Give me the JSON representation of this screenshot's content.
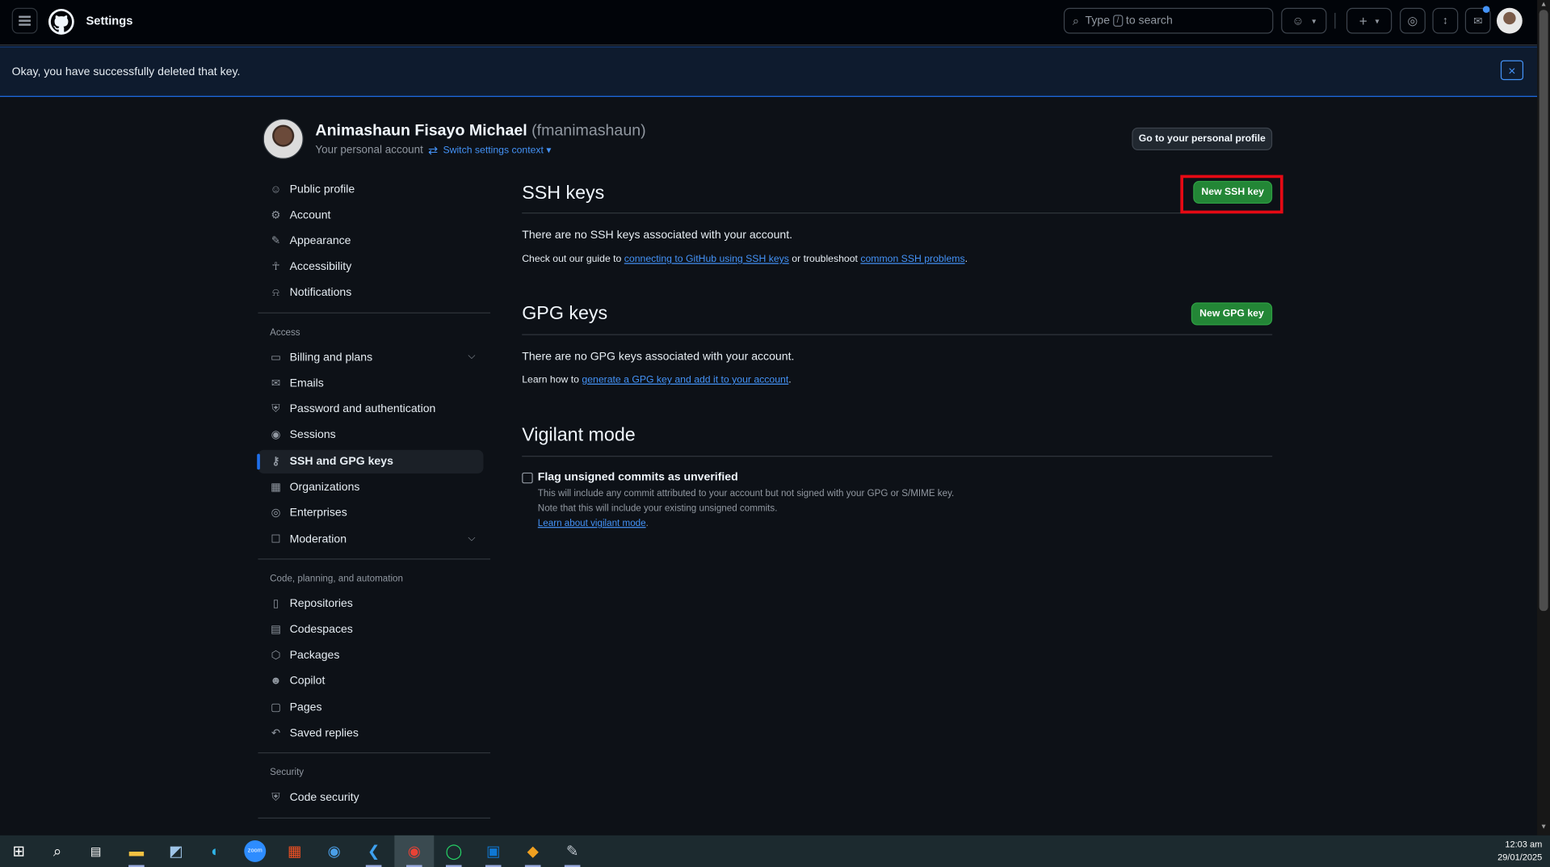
{
  "header": {
    "title": "Settings",
    "search_prefix": "Type",
    "search_key": "/",
    "search_suffix": "to search"
  },
  "flash": {
    "message": "Okay, you have successfully deleted that key.",
    "close": "×"
  },
  "profile": {
    "name": "Animashaun Fisayo Michael",
    "handle": "(fmanimashaun)",
    "subtitle": "Your personal account",
    "switch_label": "Switch settings context",
    "goto_button": "Go to your personal profile"
  },
  "sidebar": {
    "top_items": [
      {
        "label": "Public profile",
        "icon": "person-icon"
      },
      {
        "label": "Account",
        "icon": "gear-icon"
      },
      {
        "label": "Appearance",
        "icon": "paintbrush-icon"
      },
      {
        "label": "Accessibility",
        "icon": "accessibility-icon"
      },
      {
        "label": "Notifications",
        "icon": "bell-icon"
      }
    ],
    "access_heading": "Access",
    "access_items": [
      {
        "label": "Billing and plans",
        "icon": "credit-card-icon"
      },
      {
        "label": "Emails",
        "icon": "mail-icon"
      },
      {
        "label": "Password and authentication",
        "icon": "shield-lock-icon"
      },
      {
        "label": "Sessions",
        "icon": "broadcast-icon"
      },
      {
        "label": "SSH and GPG keys",
        "icon": "key-icon"
      },
      {
        "label": "Organizations",
        "icon": "organization-icon"
      },
      {
        "label": "Enterprises",
        "icon": "globe-icon"
      },
      {
        "label": "Moderation",
        "icon": "report-icon"
      }
    ],
    "code_heading": "Code, planning, and automation",
    "code_items": [
      {
        "label": "Repositories",
        "icon": "repo-icon"
      },
      {
        "label": "Codespaces",
        "icon": "codespaces-icon"
      },
      {
        "label": "Packages",
        "icon": "package-icon"
      },
      {
        "label": "Copilot",
        "icon": "copilot-icon"
      },
      {
        "label": "Pages",
        "icon": "browser-icon"
      },
      {
        "label": "Saved replies",
        "icon": "reply-icon"
      }
    ],
    "security_heading": "Security",
    "security_items": [
      {
        "label": "Code security",
        "icon": "shield-icon"
      }
    ]
  },
  "ssh": {
    "title": "SSH keys",
    "new_button": "New SSH key",
    "empty": "There are no SSH keys associated with your account.",
    "guide_prefix": "Check out our guide to",
    "guide_link": "connecting to GitHub using SSH keys",
    "guide_mid": "or troubleshoot",
    "guide_link2": "common SSH problems",
    "guide_end": "."
  },
  "gpg": {
    "title": "GPG keys",
    "new_button": "New GPG key",
    "empty": "There are no GPG keys associated with your account.",
    "learn_prefix": "Learn how to",
    "learn_link": "generate a GPG key and add it to your account",
    "learn_end": "."
  },
  "vigilant": {
    "title": "Vigilant mode",
    "checkbox_label": "Flag unsigned commits as unverified",
    "checked": false,
    "note1": "This will include any commit attributed to your account but not signed with your GPG or S/MIME key.",
    "note2": "Note that this will include your existing unsigned commits.",
    "learn_link": "Learn about vigilant mode",
    "learn_end": "."
  },
  "taskbar": {
    "time": "12:03 am",
    "date": "29/01/2025"
  },
  "colors": {
    "accent": "#4493f8",
    "green": "#238636",
    "highlight": "#e50914"
  }
}
